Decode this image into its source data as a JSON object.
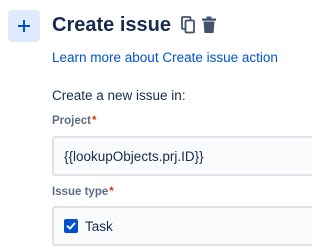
{
  "action": {
    "icon": "plus-icon",
    "title": "Create issue",
    "copy_icon": "copy-icon",
    "delete_icon": "trash-icon",
    "learn_more_link": "Learn more about Create issue action",
    "intro_text": "Create a new issue in:"
  },
  "fields": {
    "project": {
      "label": "Project",
      "required_marker": "*",
      "value": "{{lookupObjects.prj.ID}}"
    },
    "issue_type": {
      "label": "Issue type",
      "required_marker": "*",
      "value": "Task",
      "icon": "task-checkbox-icon"
    }
  },
  "colors": {
    "link": "#0052cc",
    "required": "#de350b",
    "tile_bg": "#deebff",
    "task_icon": "#0052cc"
  }
}
